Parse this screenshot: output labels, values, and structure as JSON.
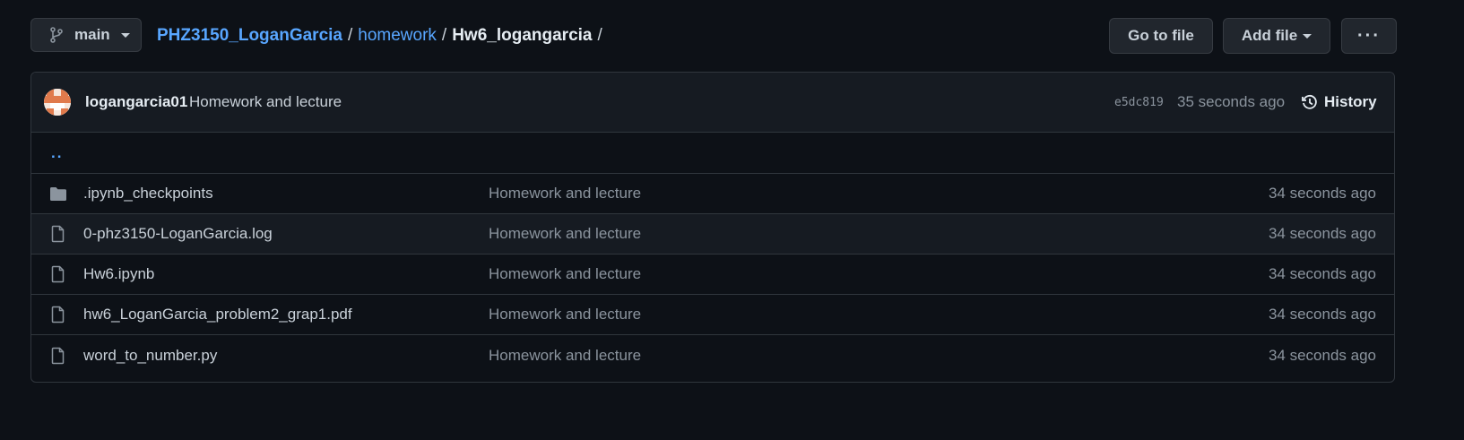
{
  "branch": {
    "name": "main"
  },
  "breadcrumb": {
    "repo": "PHZ3150_LoganGarcia",
    "sep1": "/",
    "folder": "homework",
    "sep2": "/",
    "current": "Hw6_logangarcia",
    "sep3": "/"
  },
  "toolbar": {
    "go_to_file": "Go to file",
    "add_file": "Add file",
    "more": "···"
  },
  "commit": {
    "author": "logangarcia01",
    "message": "Homework and lecture",
    "sha": "e5dc819",
    "time": "35 seconds ago",
    "history_label": "History"
  },
  "parent_dir": "..",
  "files": [
    {
      "type": "folder",
      "name": ".ipynb_checkpoints",
      "message": "Homework and lecture",
      "time": "34 seconds ago"
    },
    {
      "type": "file",
      "name": "0-phz3150-LoganGarcia.log",
      "message": "Homework and lecture",
      "time": "34 seconds ago"
    },
    {
      "type": "file",
      "name": "Hw6.ipynb",
      "message": "Homework and lecture",
      "time": "34 seconds ago"
    },
    {
      "type": "file",
      "name": "hw6_LoganGarcia_problem2_grap1.pdf",
      "message": "Homework and lecture",
      "time": "34 seconds ago"
    },
    {
      "type": "file",
      "name": "word_to_number.py",
      "message": "Homework and lecture",
      "time": "34 seconds ago"
    }
  ],
  "colors": {
    "background": "#0d1117",
    "link": "#58a6ff",
    "muted": "#8b949e",
    "border": "#30363d"
  }
}
